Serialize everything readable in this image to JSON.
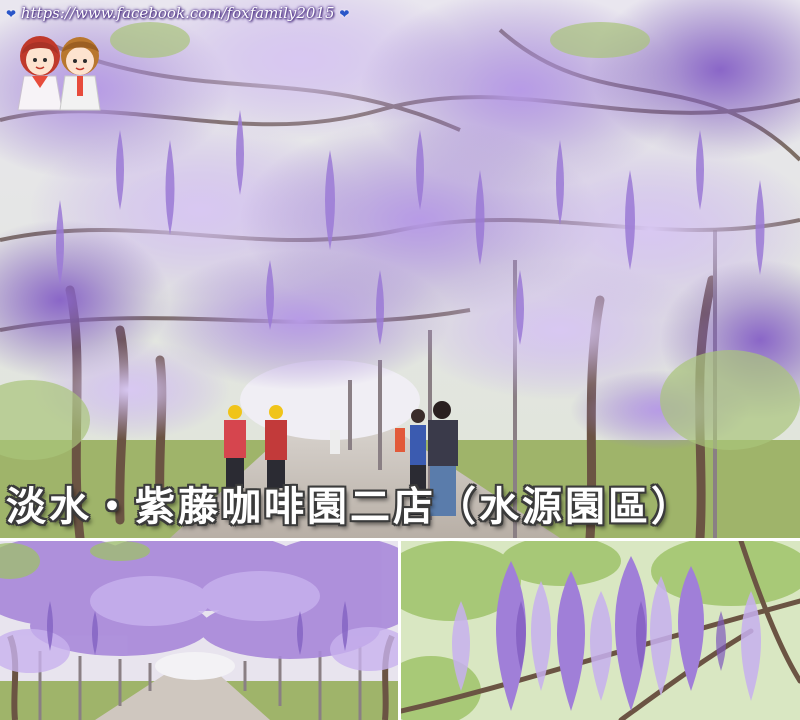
{
  "watermark": {
    "url_text": "https://www.facebook.com/foxfamily2015",
    "heart_left": "❤",
    "heart_right": "❤"
  },
  "caption": {
    "title": "淡水・紫藤咖啡園二店（水源園區）"
  },
  "colors": {
    "wisteria_light": "#c9b3ea",
    "wisteria_mid": "#a485d6",
    "wisteria_dark": "#7c5bb8",
    "foliage": "#9fbf6a",
    "trunk": "#6b5443",
    "sky": "#eef0f2",
    "caption_text": "#ffffff",
    "caption_outline": "#3b3b3b",
    "watermark_text": "#ffffff",
    "heart": "#2a56c8"
  },
  "icons": {
    "logo": "fox-family-cartoon-couple-logo"
  }
}
